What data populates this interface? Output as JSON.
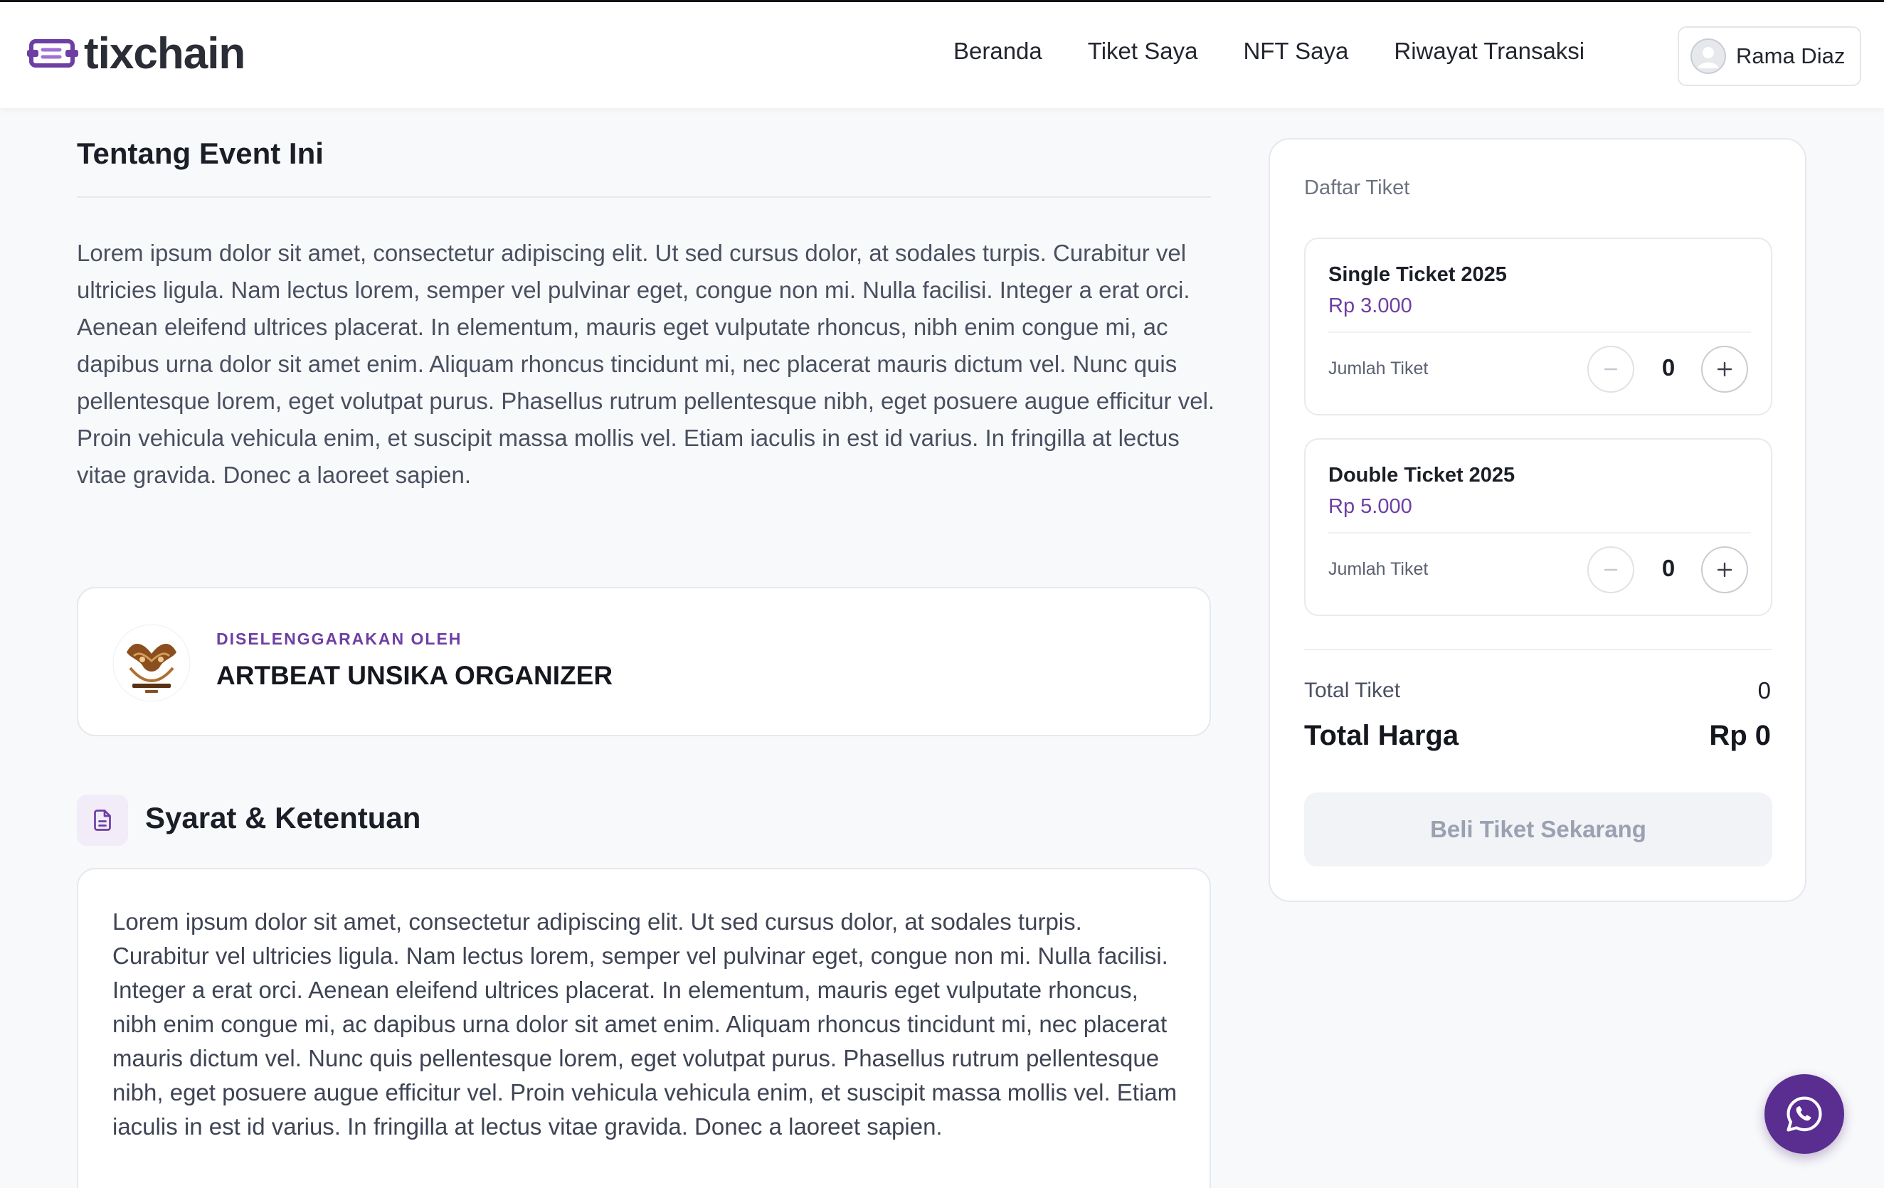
{
  "brand": {
    "name": "tixchain",
    "accent": "#6d3fa3"
  },
  "nav": {
    "links": [
      "Beranda",
      "Tiket Saya",
      "NFT Saya",
      "Riwayat Transaksi"
    ],
    "user_name": "Rama Diaz"
  },
  "about": {
    "title": "Tentang Event Ini",
    "text": "Lorem ipsum dolor sit amet, consectetur adipiscing elit. Ut sed cursus dolor, at sodales turpis. Curabitur vel ultricies ligula. Nam lectus lorem, semper vel pulvinar eget, congue non mi. Nulla facilisi. Integer a erat orci. Aenean eleifend ultrices placerat. In elementum, mauris eget vulputate rhoncus, nibh enim congue mi, ac dapibus urna dolor sit amet enim. Aliquam rhoncus tincidunt mi, nec placerat mauris dictum vel. Nunc quis pellentesque lorem, eget volutpat purus. Phasellus rutrum pellentesque nibh, eget posuere augue efficitur vel. Proin vehicula vehicula enim, et suscipit massa mollis vel. Etiam iaculis in est id varius. In fringilla at lectus vitae gravida. Donec a laoreet sapien."
  },
  "organizer": {
    "label": "DISELENGGARAKAN OLEH",
    "name": "ARTBEAT UNSIKA ORGANIZER"
  },
  "terms": {
    "title": "Syarat & Ketentuan",
    "text": "Lorem ipsum dolor sit amet, consectetur adipiscing elit. Ut sed cursus dolor, at sodales turpis. Curabitur vel ultricies ligula. Nam lectus lorem, semper vel pulvinar eget, congue non mi. Nulla facilisi. Integer a erat orci. Aenean eleifend ultrices placerat. In elementum, mauris eget vulputate rhoncus, nibh enim congue mi, ac dapibus urna dolor sit amet enim. Aliquam rhoncus tincidunt mi, nec placerat mauris dictum vel. Nunc quis pellentesque lorem, eget volutpat purus. Phasellus rutrum pellentesque nibh, eget posuere augue efficitur vel. Proin vehicula vehicula enim, et suscipit massa mollis vel. Etiam iaculis in est id varius. In fringilla at lectus vitae gravida. Donec a laoreet sapien."
  },
  "tickets": {
    "title": "Daftar Tiket",
    "items": [
      {
        "name": "Single Ticket 2025",
        "price": "Rp 3.000",
        "qty_label": "Jumlah Tiket",
        "qty": "0"
      },
      {
        "name": "Double Ticket 2025",
        "price": "Rp 5.000",
        "qty_label": "Jumlah Tiket",
        "qty": "0"
      }
    ],
    "total_tickets_label": "Total Tiket",
    "total_tickets": "0",
    "total_price_label": "Total Harga",
    "total_price": "Rp 0",
    "buy_label": "Beli Tiket Sekarang"
  },
  "icons": {
    "brand": "ticket-chain-icon",
    "avatar": "user-avatar-icon",
    "terms": "document-icon",
    "minus": "minus-icon",
    "plus": "plus-icon",
    "whatsapp": "whatsapp-icon"
  }
}
